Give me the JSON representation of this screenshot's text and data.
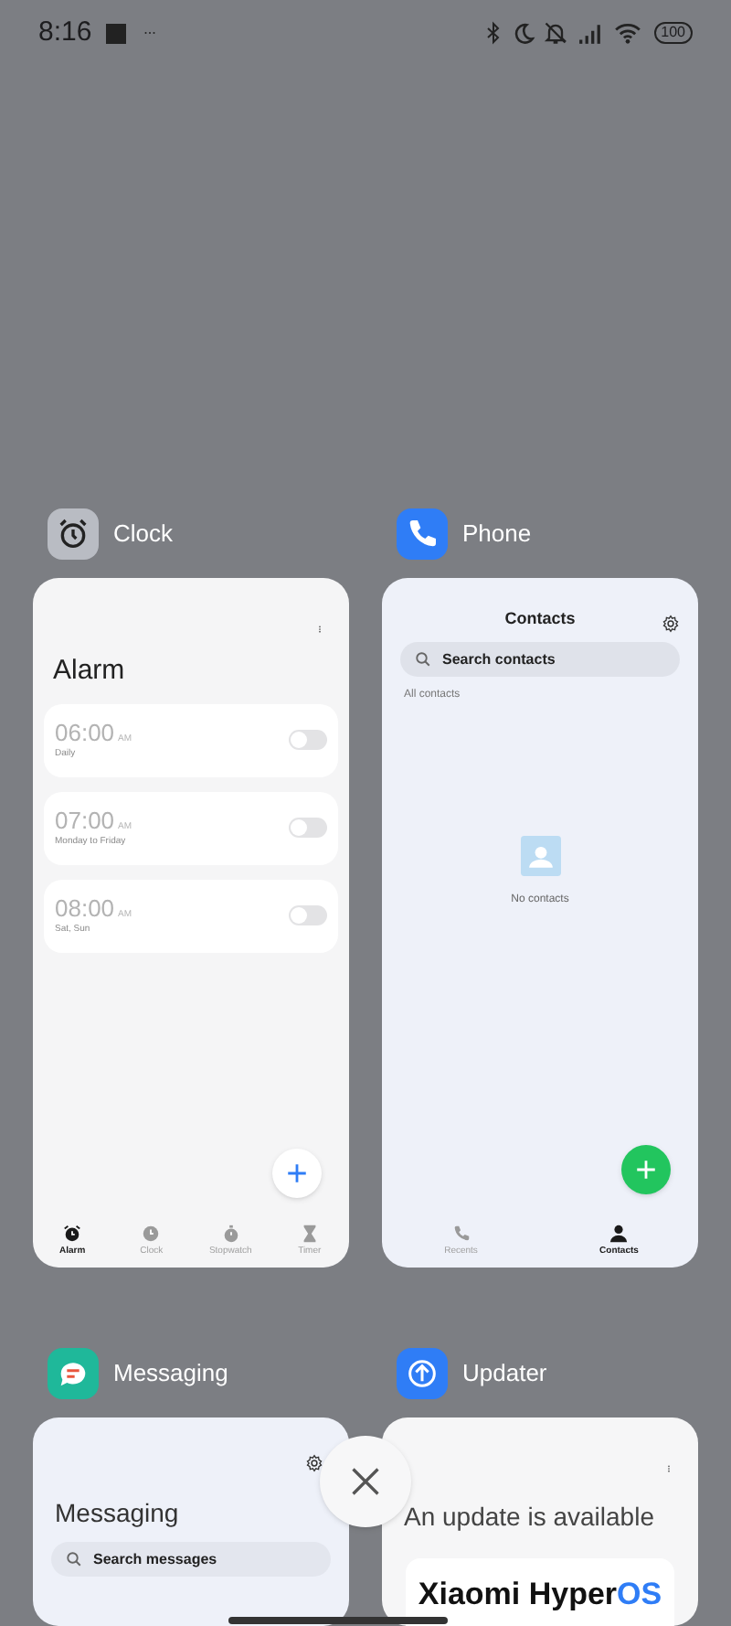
{
  "status_bar": {
    "time": "8:16",
    "battery": "100"
  },
  "recent_apps": [
    {
      "kind": "clock",
      "app_name": "Clock",
      "title": "Alarm",
      "alarms": [
        {
          "time": "06:00",
          "period": "AM",
          "repeat": "Daily",
          "on": false
        },
        {
          "time": "07:00",
          "period": "AM",
          "repeat": "Monday to Friday",
          "on": false
        },
        {
          "time": "08:00",
          "period": "AM",
          "repeat": "Sat, Sun",
          "on": false
        }
      ],
      "tabs": [
        {
          "label": "Alarm",
          "selected": true
        },
        {
          "label": "Clock",
          "selected": false
        },
        {
          "label": "Stopwatch",
          "selected": false
        },
        {
          "label": "Timer",
          "selected": false
        }
      ]
    },
    {
      "kind": "phone",
      "app_name": "Phone",
      "title": "Contacts",
      "search_placeholder": "Search contacts",
      "filter": "All contacts",
      "empty_text": "No contacts",
      "tabs": [
        {
          "label": "Recents",
          "selected": false
        },
        {
          "label": "Contacts",
          "selected": true
        }
      ]
    },
    {
      "kind": "messaging",
      "app_name": "Messaging",
      "title": "Messaging",
      "search_placeholder": "Search messages"
    },
    {
      "kind": "updater",
      "app_name": "Updater",
      "title": "An update is available",
      "brand": "Xiaomi Hyper",
      "brand_accent": "OS"
    }
  ]
}
